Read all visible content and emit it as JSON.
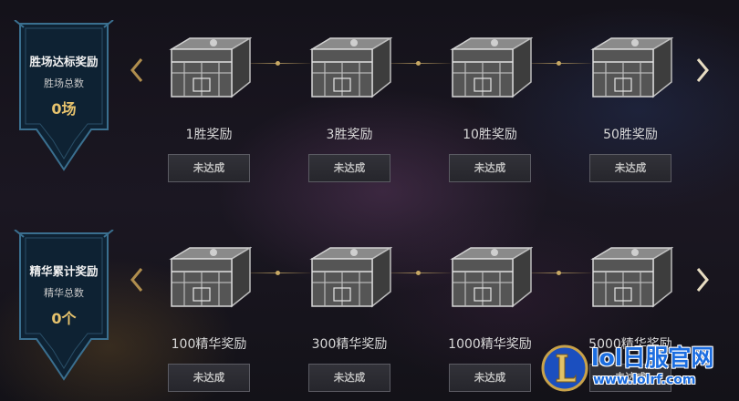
{
  "sections": [
    {
      "badge": {
        "title": "胜场达标奖励",
        "subtitle": "胜场总数",
        "value": "0场"
      },
      "rewards": [
        {
          "label": "1胜奖励",
          "status": "未达成"
        },
        {
          "label": "3胜奖励",
          "status": "未达成"
        },
        {
          "label": "10胜奖励",
          "status": "未达成"
        },
        {
          "label": "50胜奖励",
          "status": "未达成"
        }
      ]
    },
    {
      "badge": {
        "title": "精华累计奖励",
        "subtitle": "精华总数",
        "value": "0个"
      },
      "rewards": [
        {
          "label": "100精华奖励",
          "status": "未达成"
        },
        {
          "label": "300精华奖励",
          "status": "未达成"
        },
        {
          "label": "1000精华奖励",
          "status": "未达成"
        },
        {
          "label": "5000精华奖励",
          "status": "未达成"
        }
      ]
    }
  ],
  "icons": {
    "badge": "shield-badge-icon",
    "chest": "hextech-chest-icon",
    "prev": "chevron-left-icon",
    "next": "chevron-right-icon",
    "watermark_logo": "league-logo-icon"
  },
  "colors": {
    "badge_fill": "#0e2233",
    "badge_border": "#3a6f8f",
    "badge_value": "#e7c36d",
    "arrow_gold": "#b08e4e",
    "button_border": "#5b5b63",
    "watermark_blue": "#1b6de0"
  },
  "watermark": {
    "site_name": "lol日服官网",
    "url": "www.lolrf.com"
  }
}
